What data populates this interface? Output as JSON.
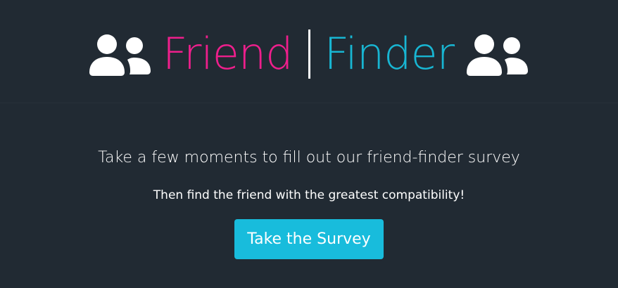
{
  "header": {
    "title_left": "Friend",
    "title_separator": "|",
    "title_right": "Finder",
    "icon_left": "users-icon",
    "icon_right": "users-icon",
    "colors": {
      "friend": "#ee1f8c",
      "finder": "#18b6d3",
      "background": "#212a33"
    }
  },
  "main": {
    "tagline": "Take a few moments to fill out our friend-finder survey",
    "subtagline": "Then find the friend with the greatest compatibility!",
    "survey_button_label": "Take the Survey",
    "button_color": "#18bcdc"
  }
}
